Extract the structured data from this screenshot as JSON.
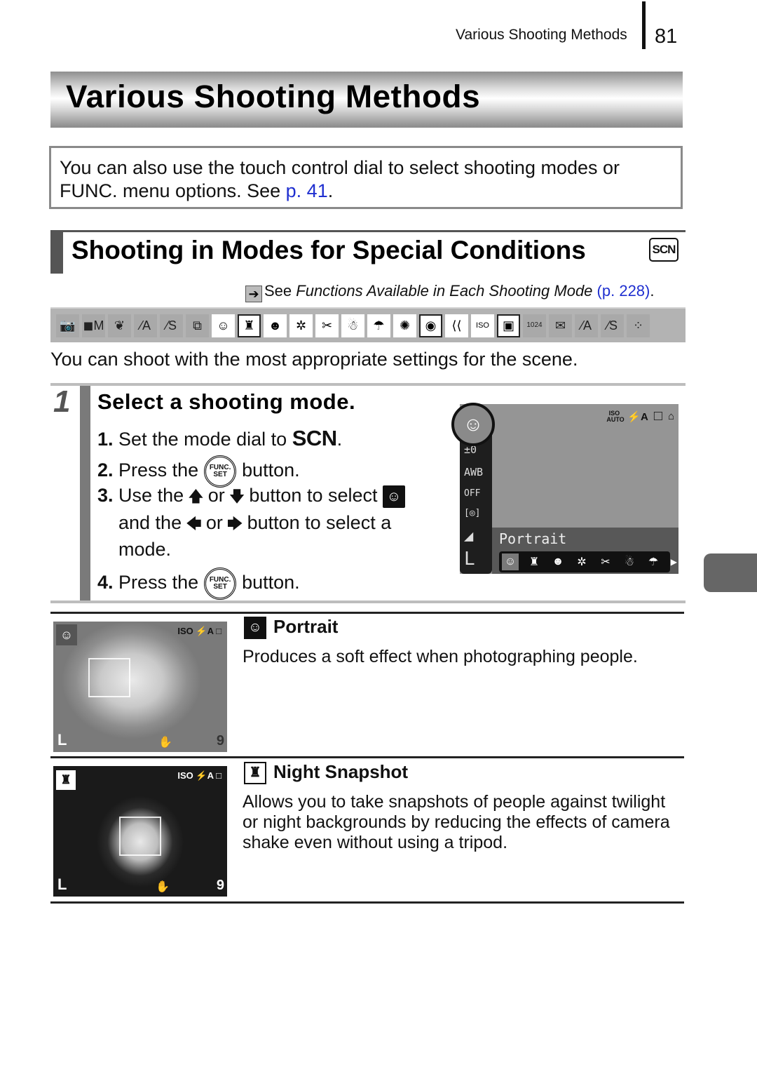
{
  "header": {
    "running_title": "Various Shooting Methods",
    "page_number": "81"
  },
  "chapter": {
    "title": "Various Shooting Methods"
  },
  "note": {
    "text_before_link": "You can also use the touch control dial to select shooting modes or FUNC. menu options. See ",
    "link_text": "p. 41",
    "text_after_link": "."
  },
  "section": {
    "title": "Shooting in Modes for Special Conditions",
    "badge": "SCN",
    "see_prefix": "See ",
    "see_italic": "Functions Available in Each Shooting Mode",
    "see_link": "(p. 228)",
    "see_suffix": ".",
    "see_arrow_icon": "➔"
  },
  "mode_strip": {
    "icons": [
      {
        "name": "auto-camera-icon",
        "glyph": "📷",
        "state": "dim"
      },
      {
        "name": "manual-camera-icon",
        "glyph": "◼M",
        "state": "dim"
      },
      {
        "name": "digital-macro-icon",
        "glyph": "❦",
        "state": "dim"
      },
      {
        "name": "color-accent-icon",
        "glyph": "⁄A",
        "state": "dim"
      },
      {
        "name": "color-swap-icon",
        "glyph": "⁄S",
        "state": "dim"
      },
      {
        "name": "stitch-assist-icon",
        "glyph": "⧉",
        "state": "dim"
      },
      {
        "name": "portrait-icon",
        "glyph": "☺",
        "state": "lit"
      },
      {
        "name": "night-snapshot-icon",
        "glyph": "♜",
        "state": "box"
      },
      {
        "name": "kids-pets-icon",
        "glyph": "☻",
        "state": "lit"
      },
      {
        "name": "indoor-icon",
        "glyph": "✲",
        "state": "lit"
      },
      {
        "name": "foliage-icon",
        "glyph": "✂",
        "state": "lit"
      },
      {
        "name": "snow-icon",
        "glyph": "☃",
        "state": "lit"
      },
      {
        "name": "beach-icon",
        "glyph": "☂",
        "state": "lit"
      },
      {
        "name": "fireworks-icon",
        "glyph": "✺",
        "state": "lit"
      },
      {
        "name": "aquarium-icon",
        "glyph": "◉",
        "state": "box"
      },
      {
        "name": "underwater-icon",
        "glyph": "⟨⟨",
        "state": "lit"
      },
      {
        "name": "iso-3200-icon",
        "glyph": "ISO",
        "state": "lit"
      },
      {
        "name": "movie-standard-icon",
        "glyph": "▣",
        "state": "box"
      },
      {
        "name": "movie-1024-icon",
        "glyph": "1024",
        "state": "dim"
      },
      {
        "name": "movie-email-icon",
        "glyph": "✉",
        "state": "dim"
      },
      {
        "name": "movie-color-accent-icon",
        "glyph": "⁄A",
        "state": "dim"
      },
      {
        "name": "movie-color-swap-icon",
        "glyph": "⁄S",
        "state": "dim"
      },
      {
        "name": "movie-time-lapse-icon",
        "glyph": "⁘",
        "state": "dim"
      }
    ]
  },
  "intro": "You can shoot with the most appropriate settings for the scene.",
  "step": {
    "number": "1",
    "title": "Select a shooting mode.",
    "substeps": {
      "s1_num": "1.",
      "s1_text": "Set the mode dial to ",
      "s1_scn": "SCN",
      "s1_end": ".",
      "s2_num": "2.",
      "s2_text": "Press the",
      "s2_end": "button.",
      "s3_num": "3.",
      "s3_text_a": "Use the",
      "s3_or": "or",
      "s3_text_b": "button to select",
      "s3_line2_a": "and the",
      "s3_line2_or": "or",
      "s3_line2_b": "button to select a",
      "s3_line3": "mode.",
      "s4_num": "4.",
      "s4_text": "Press the",
      "s4_end": "button."
    },
    "func_button": {
      "line1": "FUNC.",
      "line2": "SET"
    },
    "arrows": {
      "up": "🡅",
      "down": "🡇",
      "left": "🡄",
      "right": "🡆"
    }
  },
  "lcd": {
    "mode_name": "Portrait",
    "top_icons": [
      "ISO AUTO",
      "⚡A",
      "□",
      "⌂"
    ],
    "left_labels": [
      "±0",
      "AWB",
      "OFF",
      "[◎]",
      "◢",
      "L"
    ],
    "mode_row": [
      "☺",
      "♜",
      "☻",
      "✲",
      "✂",
      "☃",
      "☂"
    ],
    "more_arrow": "▶"
  },
  "modes": [
    {
      "name": "Portrait",
      "icon": "☺",
      "description": "Produces a soft effect when photographing people."
    },
    {
      "name": "Night Snapshot",
      "icon": "♜",
      "description": "Allows you to take snapshots of people against twilight or night backgrounds by reducing the effects of camera shake even without using a tripod."
    }
  ],
  "photo_overlay": {
    "iso": "ISO",
    "flash": "⚡A",
    "frame": "□",
    "quality": "L",
    "shots": "9",
    "hand": "✋"
  }
}
